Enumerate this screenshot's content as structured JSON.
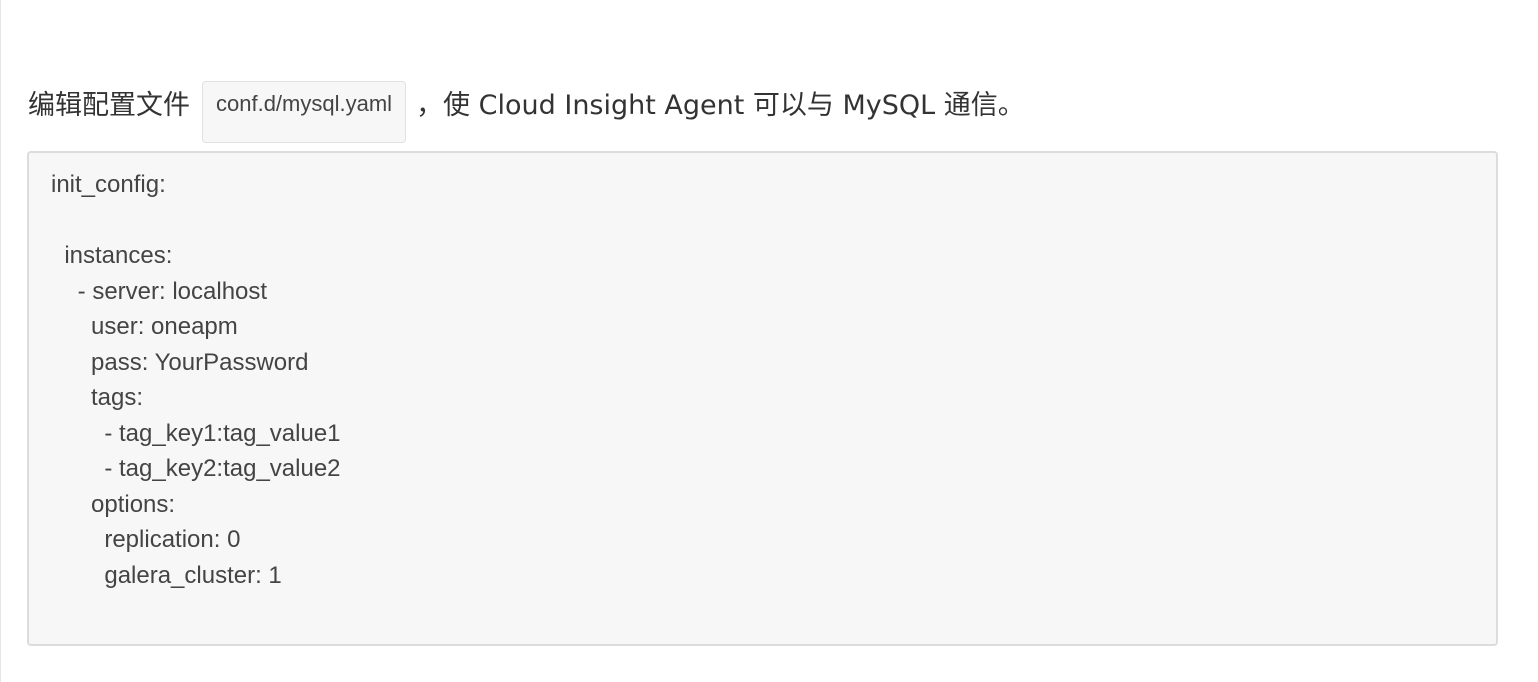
{
  "intro": {
    "prefix": "编辑配置文件",
    "file_name": "conf.d/mysql.yaml",
    "suffix": "，使 Cloud Insight Agent 可以与 MySQL 通信。"
  },
  "code_block": {
    "lines": [
      "init_config:",
      "",
      "  instances:",
      "    - server: localhost",
      "      user: oneapm",
      "      pass: YourPassword",
      "      tags:",
      "        - tag_key1:tag_value1",
      "        - tag_key2:tag_value2",
      "      options:",
      "        replication: 0",
      "        galera_cluster: 1"
    ]
  }
}
